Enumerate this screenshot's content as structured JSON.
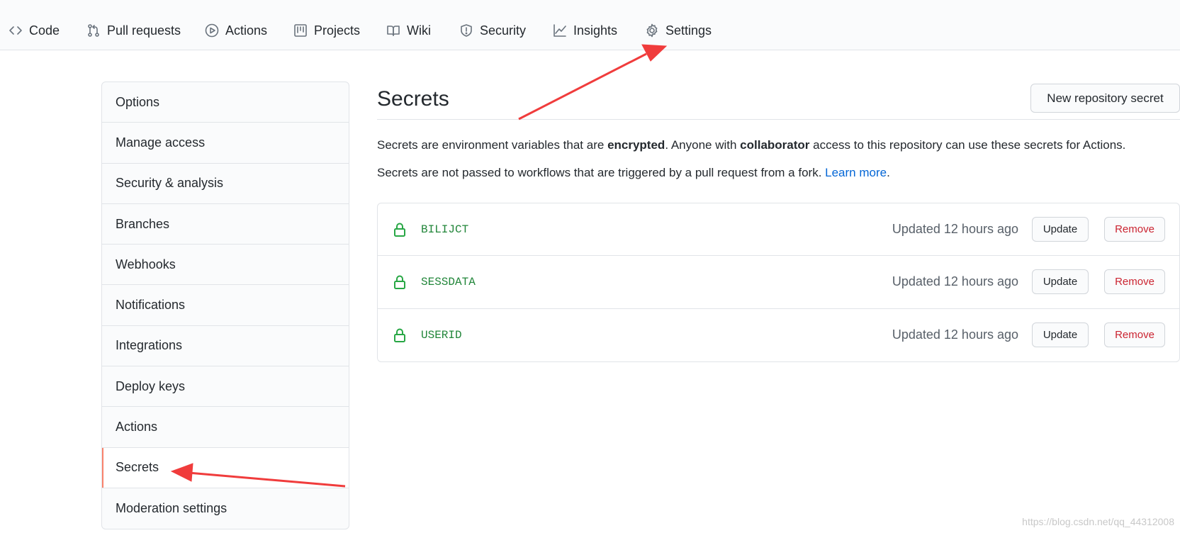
{
  "nav": {
    "tabs": [
      {
        "label": "Code",
        "icon": "code-icon"
      },
      {
        "label": "Pull requests",
        "icon": "pull-request-icon"
      },
      {
        "label": "Actions",
        "icon": "play-icon"
      },
      {
        "label": "Projects",
        "icon": "project-icon"
      },
      {
        "label": "Wiki",
        "icon": "book-icon"
      },
      {
        "label": "Security",
        "icon": "shield-icon"
      },
      {
        "label": "Insights",
        "icon": "graph-icon"
      },
      {
        "label": "Settings",
        "icon": "gear-icon"
      }
    ]
  },
  "sidebar": {
    "items": [
      {
        "label": "Options"
      },
      {
        "label": "Manage access"
      },
      {
        "label": "Security & analysis"
      },
      {
        "label": "Branches"
      },
      {
        "label": "Webhooks"
      },
      {
        "label": "Notifications"
      },
      {
        "label": "Integrations"
      },
      {
        "label": "Deploy keys"
      },
      {
        "label": "Actions"
      },
      {
        "label": "Secrets",
        "selected": true
      },
      {
        "label": "Moderation settings"
      }
    ]
  },
  "main": {
    "title": "Secrets",
    "new_button": "New repository secret",
    "desc1": {
      "part1": "Secrets are environment variables that are ",
      "bold1": "encrypted",
      "part2": ". Anyone with ",
      "bold2": "collaborator",
      "part3": " access to this repository can use these secrets for Actions."
    },
    "desc2": {
      "text": "Secrets are not passed to workflows that are triggered by a pull request from a fork. ",
      "link": "Learn more",
      "end": "."
    },
    "secrets": [
      {
        "name": "BILIJCT",
        "updated": "Updated 12 hours ago",
        "update_label": "Update",
        "remove_label": "Remove"
      },
      {
        "name": "SESSDATA",
        "updated": "Updated 12 hours ago",
        "update_label": "Update",
        "remove_label": "Remove"
      },
      {
        "name": "USERID",
        "updated": "Updated 12 hours ago",
        "update_label": "Update",
        "remove_label": "Remove"
      }
    ]
  },
  "colors": {
    "accent_selected": "#f9826c",
    "secret_name": "#22863a",
    "lock": "#28a745",
    "remove": "#cb2431",
    "link": "#0366d6",
    "annotation_arrow": "#f03c3c"
  },
  "watermark": "https://blog.csdn.net/qq_44312008"
}
